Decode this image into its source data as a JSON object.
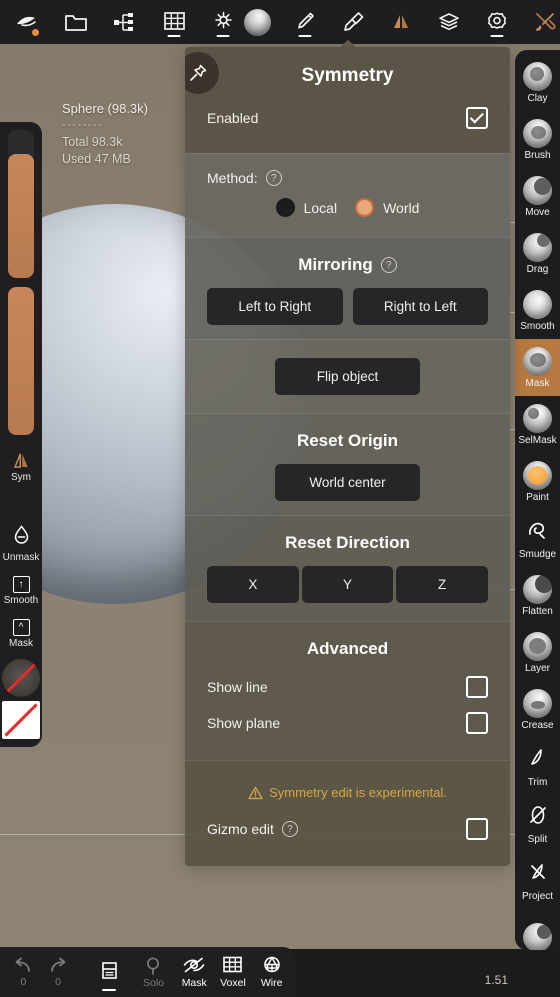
{
  "app": {
    "version": "1.51"
  },
  "topbar": {
    "left_items": [
      {
        "name": "sculpt-menu",
        "icon": "sculpt-icon",
        "has_dot": true,
        "has_underbar": false
      },
      {
        "name": "files",
        "icon": "folder-icon",
        "has_dot": false,
        "has_underbar": false
      },
      {
        "name": "scene-graph",
        "icon": "scene-graph-icon",
        "has_dot": false,
        "has_underbar": false
      },
      {
        "name": "grid",
        "icon": "grid-icon",
        "has_dot": false,
        "has_underbar": true
      },
      {
        "name": "lighting",
        "icon": "sun-icon",
        "has_dot": false,
        "has_underbar": true
      }
    ],
    "right_items": [
      {
        "name": "matcap",
        "icon": "sphere-matcap-icon",
        "has_underbar": false,
        "accent": false
      },
      {
        "name": "brush-settings",
        "icon": "brush-icon",
        "has_underbar": true,
        "accent": false
      },
      {
        "name": "paint-settings",
        "icon": "paint-roller-icon",
        "has_underbar": false,
        "accent": false
      },
      {
        "name": "symmetry",
        "icon": "symmetry-icon",
        "has_underbar": false,
        "accent": true
      },
      {
        "name": "layers",
        "icon": "layers-icon",
        "has_underbar": false,
        "accent": false
      },
      {
        "name": "settings",
        "icon": "gear-icon",
        "has_underbar": true,
        "accent": false
      },
      {
        "name": "tools",
        "icon": "tools-icon",
        "has_underbar": false,
        "accent": true
      }
    ]
  },
  "viewport": {
    "stats": {
      "object_name": "Sphere (98.3k)",
      "divider": "--------",
      "total": "Total 98.3k",
      "memory": "Used 47 MB"
    }
  },
  "left_sidebar": {
    "sliders": [
      {
        "name": "radius-slider",
        "fill_percent": 84
      },
      {
        "name": "intensity-slider",
        "fill_percent": 100
      }
    ],
    "items": [
      {
        "name": "sym",
        "label": "Sym",
        "icon": "symmetry-icon",
        "active": true
      },
      {
        "name": "unmask",
        "label": "Unmask",
        "icon": "droplet-minus-icon",
        "active": false
      },
      {
        "name": "smooth",
        "label": "Smooth",
        "icon": "square-up-arrow-icon",
        "active": false
      },
      {
        "name": "mask",
        "label": "Mask",
        "icon": "square-caret-up-icon",
        "active": false
      }
    ],
    "swatches": [
      {
        "name": "matcap-swatch",
        "shape": "circle",
        "struck": true
      },
      {
        "name": "color-swatch",
        "shape": "square",
        "struck": true
      }
    ]
  },
  "right_sidebar": {
    "tools": [
      {
        "name": "clay",
        "label": "Clay",
        "active": false
      },
      {
        "name": "brush",
        "label": "Brush",
        "active": false
      },
      {
        "name": "move",
        "label": "Move",
        "active": false
      },
      {
        "name": "drag",
        "label": "Drag",
        "active": false
      },
      {
        "name": "smooth",
        "label": "Smooth",
        "active": false
      },
      {
        "name": "mask",
        "label": "Mask",
        "active": true
      },
      {
        "name": "selmask",
        "label": "SelMask",
        "active": false
      },
      {
        "name": "paint",
        "label": "Paint",
        "active": false
      },
      {
        "name": "smudge",
        "label": "Smudge",
        "active": false
      },
      {
        "name": "flatten",
        "label": "Flatten",
        "active": false
      },
      {
        "name": "layer",
        "label": "Layer",
        "active": false
      },
      {
        "name": "crease",
        "label": "Crease",
        "active": false
      },
      {
        "name": "trim",
        "label": "Trim",
        "active": false
      },
      {
        "name": "split",
        "label": "Split",
        "active": false
      },
      {
        "name": "project",
        "label": "Project",
        "active": false
      }
    ]
  },
  "panel": {
    "title": "Symmetry",
    "pin_icon": "pin-icon",
    "enabled": {
      "label": "Enabled",
      "checked": true
    },
    "method": {
      "label": "Method:",
      "help": "?",
      "options": [
        {
          "label": "Local",
          "selected": false
        },
        {
          "label": "World",
          "selected": true
        }
      ]
    },
    "mirroring": {
      "title": "Mirroring",
      "help": "?",
      "left_to_right": "Left to Right",
      "right_to_left": "Right to Left",
      "flip_object": "Flip object"
    },
    "reset_origin": {
      "title": "Reset Origin",
      "world_center": "World center"
    },
    "reset_direction": {
      "title": "Reset Direction",
      "axes": [
        "X",
        "Y",
        "Z"
      ]
    },
    "advanced": {
      "title": "Advanced",
      "show_line": {
        "label": "Show line",
        "checked": false
      },
      "show_plane": {
        "label": "Show plane",
        "checked": false
      },
      "warning": "Symmetry edit is experimental.",
      "gizmo_edit": {
        "label": "Gizmo edit",
        "help": "?",
        "checked": false
      }
    }
  },
  "bottombar": {
    "items": [
      {
        "name": "undo",
        "label": "0",
        "icon": "undo-arrow-icon",
        "dim": true,
        "underbar": false
      },
      {
        "name": "redo",
        "label": "0",
        "icon": "redo-arrow-icon",
        "dim": true,
        "underbar": false
      },
      {
        "name": "layers",
        "label": "",
        "icon": "layers-panel-icon",
        "dim": false,
        "underbar": true
      },
      {
        "name": "solo",
        "label": "Solo",
        "icon": "magnifier-icon",
        "dim": true,
        "underbar": false
      },
      {
        "name": "mask",
        "label": "Mask",
        "icon": "eye-slash-icon",
        "dim": false,
        "underbar": false
      },
      {
        "name": "voxel",
        "label": "Voxel",
        "icon": "voxel-grid-icon",
        "dim": false,
        "underbar": false
      },
      {
        "name": "wire",
        "label": "Wire",
        "icon": "wireframe-icon",
        "dim": false,
        "underbar": false
      }
    ]
  },
  "colors": {
    "accent_orange": "#b5793f",
    "warn_yellow": "#d9a743",
    "panel_bg": "#605c52",
    "toolbar_bg": "#1e1e20"
  }
}
